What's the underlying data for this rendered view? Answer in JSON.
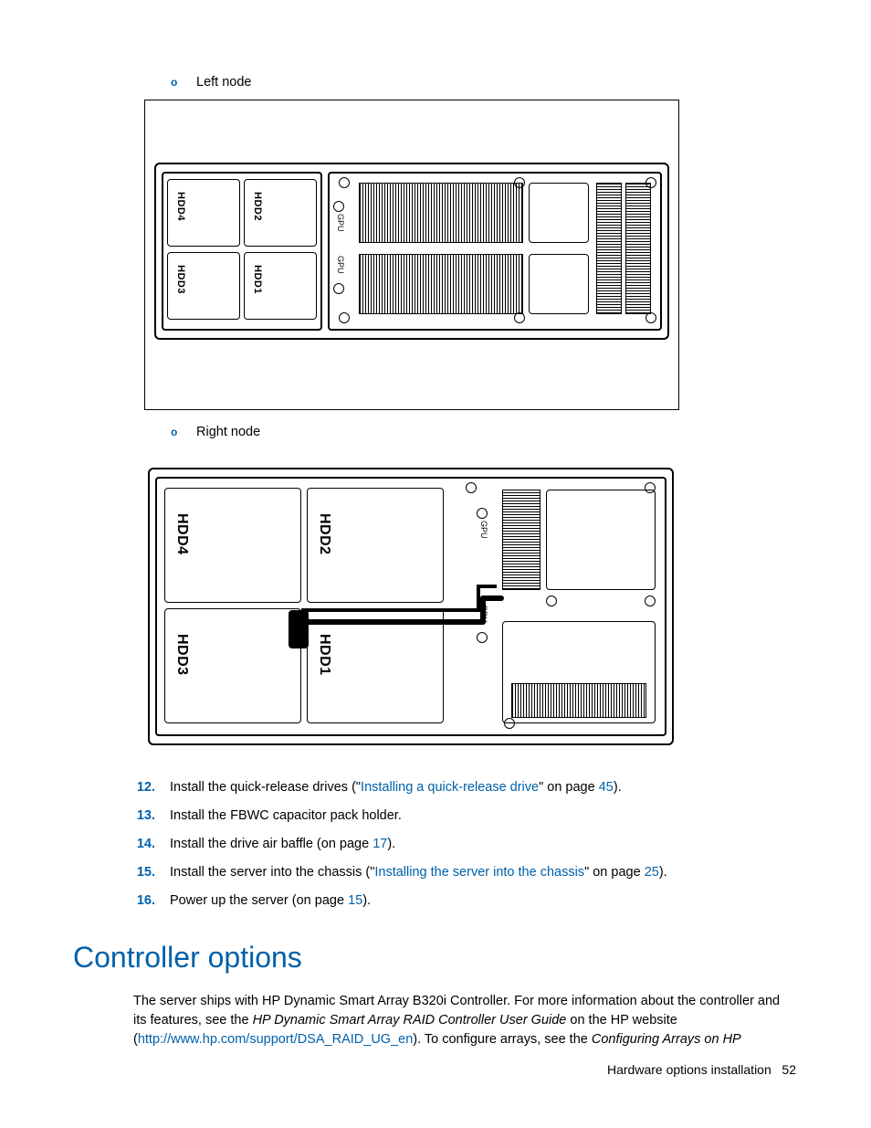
{
  "bullets": {
    "left": "Left node",
    "right": "Right node",
    "marker": "o"
  },
  "hdd": {
    "l1": "HDD1",
    "l2": "HDD2",
    "l3": "HDD3",
    "l4": "HDD4"
  },
  "gpu": "GPU",
  "steps": {
    "s12": {
      "n": "12.",
      "pre": "Install the quick-release drives (\"",
      "link": "Installing a quick-release drive",
      "mid": "\" on page ",
      "page": "45",
      "post": ")."
    },
    "s13": {
      "n": "13.",
      "text": "Install the FBWC capacitor pack holder."
    },
    "s14": {
      "n": "14.",
      "pre": "Install the drive air baffle (on page ",
      "page": "17",
      "post": ")."
    },
    "s15": {
      "n": "15.",
      "pre": "Install the server into the chassis (\"",
      "link": "Installing the server into the chassis",
      "mid": "\" on page ",
      "page": "25",
      "post": ")."
    },
    "s16": {
      "n": "16.",
      "pre": "Power up the server (on page ",
      "page": "15",
      "post": ")."
    }
  },
  "heading": "Controller options",
  "para": {
    "t1": "The server ships with HP Dynamic Smart Array B320i Controller. For more information about the controller and its features, see the ",
    "i1": "HP Dynamic Smart Array RAID Controller User Guide",
    "t2": " on the HP website (",
    "url": "http://www.hp.com/support/DSA_RAID_UG_en",
    "t3": "). To configure arrays, see the ",
    "i2": "Configuring Arrays on HP"
  },
  "footer": {
    "section": "Hardware options installation",
    "page": "52"
  }
}
